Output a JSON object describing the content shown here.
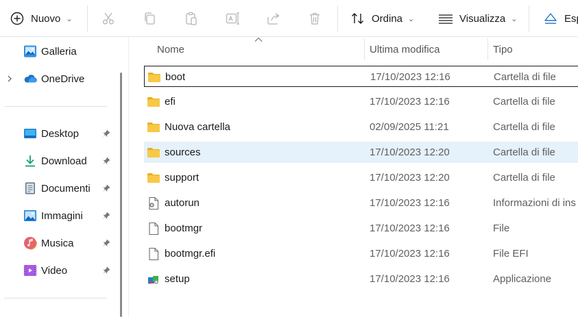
{
  "toolbar": {
    "new_label": "Nuovo",
    "sort_label": "Ordina",
    "view_label": "Visualizza",
    "extract_label": "Esp",
    "icons": [
      "plus-circle-icon",
      "scissors-icon",
      "copy-icon",
      "paste-icon",
      "rename-icon",
      "share-icon",
      "delete-icon",
      "sort-icon",
      "view-icon",
      "eject-icon"
    ]
  },
  "sidebar": {
    "top_items": [
      {
        "label": "Galleria",
        "icon": "gallery-icon"
      },
      {
        "label": "OneDrive",
        "icon": "cloud-icon",
        "expandable": true
      }
    ],
    "quick_access": [
      {
        "label": "Desktop",
        "icon": "desktop-icon",
        "pinned": true
      },
      {
        "label": "Download",
        "icon": "download-icon",
        "pinned": true
      },
      {
        "label": "Documenti",
        "icon": "documents-icon",
        "pinned": true
      },
      {
        "label": "Immagini",
        "icon": "pictures-icon",
        "pinned": true
      },
      {
        "label": "Musica",
        "icon": "music-icon",
        "pinned": true
      },
      {
        "label": "Video",
        "icon": "video-icon",
        "pinned": true
      }
    ]
  },
  "filelist": {
    "columns": {
      "name": "Nome",
      "modified": "Ultima modifica",
      "type": "Tipo"
    },
    "sort": {
      "column": "name",
      "direction": "ascending"
    },
    "rows": [
      {
        "name": "boot",
        "modified": "17/10/2023 12:16",
        "type": "Cartella di file",
        "icon": "folder-icon",
        "focused": true
      },
      {
        "name": "efi",
        "modified": "17/10/2023 12:16",
        "type": "Cartella di file",
        "icon": "folder-icon"
      },
      {
        "name": "Nuova cartella",
        "modified": "02/09/2025 11:21",
        "type": "Cartella di file",
        "icon": "folder-icon"
      },
      {
        "name": "sources",
        "modified": "17/10/2023 12:20",
        "type": "Cartella di file",
        "icon": "folder-icon",
        "hovered": true
      },
      {
        "name": "support",
        "modified": "17/10/2023 12:20",
        "type": "Cartella di file",
        "icon": "folder-icon"
      },
      {
        "name": "autorun",
        "modified": "17/10/2023 12:16",
        "type": "Informazioni di ins",
        "icon": "settings-file-icon"
      },
      {
        "name": "bootmgr",
        "modified": "17/10/2023 12:16",
        "type": "File",
        "icon": "file-icon"
      },
      {
        "name": "bootmgr.efi",
        "modified": "17/10/2023 12:16",
        "type": "File EFI",
        "icon": "file-icon"
      },
      {
        "name": "setup",
        "modified": "17/10/2023 12:16",
        "type": "Applicazione",
        "icon": "setup-app-icon"
      }
    ]
  },
  "colors": {
    "folder": "#f8c846",
    "folder_dark": "#e9ad1c",
    "hover_row": "#e5f1fb",
    "accent_blue": "#1a73c7"
  }
}
